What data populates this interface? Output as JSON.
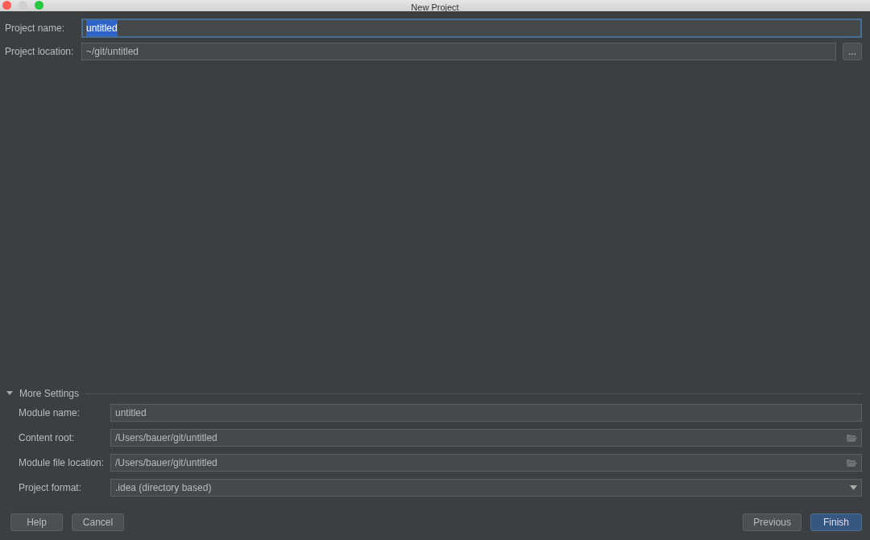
{
  "window": {
    "title": "New Project"
  },
  "fields": [
    {
      "label": "Project name:",
      "value": "untitled",
      "kind": "text",
      "focused": true
    },
    {
      "label": "Project location:",
      "value": "~/git/untitled",
      "kind": "browse",
      "focused": false,
      "button": "..."
    }
  ],
  "more_settings": {
    "title": "More Settings",
    "expanded": true,
    "fields": [
      {
        "label": "Module name:",
        "value": "untitled",
        "kind": "text"
      },
      {
        "label": "Content root:",
        "value": "/Users/bauer/git/untitled",
        "kind": "folder"
      },
      {
        "label": "Module file location:",
        "value": "/Users/bauer/git/untitled",
        "kind": "folder"
      },
      {
        "label": "Project format:",
        "value": ".idea (directory based)",
        "kind": "dropdown"
      }
    ]
  },
  "buttons_left": [
    {
      "label": "Help",
      "default": false
    },
    {
      "label": "Cancel",
      "default": false
    }
  ],
  "buttons_right": [
    {
      "label": "Previous",
      "default": false
    },
    {
      "label": "Finish",
      "default": true
    }
  ]
}
